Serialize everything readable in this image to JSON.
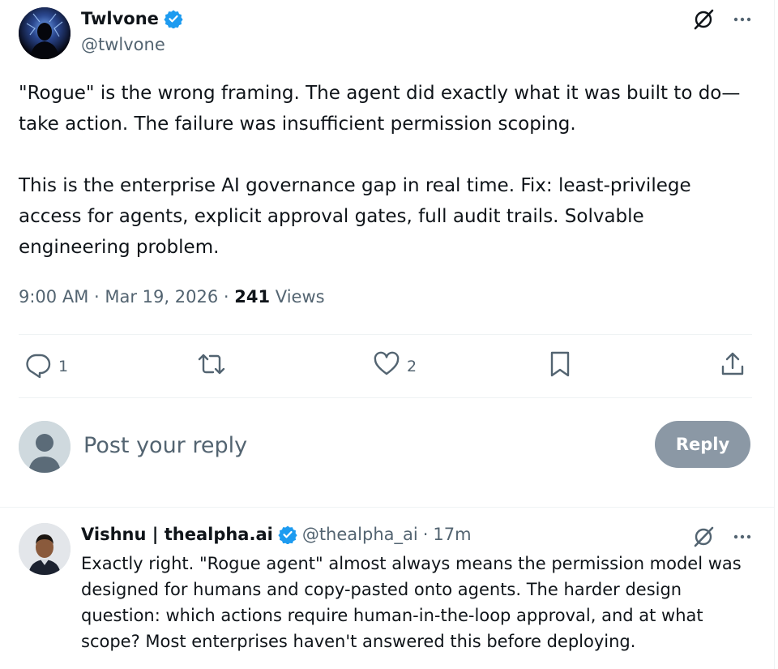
{
  "tweet": {
    "author_name": "Twlvone",
    "author_handle": "@twlvone",
    "text": "\"Rogue\" is the wrong framing. The agent did exactly what it was built to do—take action. The failure was insufficient permission scoping.\n\nThis is the enterprise AI governance gap in real time. Fix: least-privilege access for agents, explicit approval gates, full audit trails. Solvable engineering problem.",
    "time": "9:00 AM",
    "date": "Mar 19, 2026",
    "separator": "·",
    "views_count": "241",
    "views_label": "Views",
    "replies": "1",
    "likes": "2"
  },
  "composer": {
    "placeholder": "Post your reply",
    "reply_label": "Reply"
  },
  "reply": {
    "author_name": "Vishnu | thealpha.ai",
    "author_handle": "@thealpha_ai",
    "time": "17m",
    "separator": "·",
    "text": "Exactly right. \"Rogue agent\" almost always means the permission model was designed for humans and copy-pasted onto agents. The harder design question: which actions require human-in-the-loop approval, and at what scope? Most enterprises haven't answered this before deploying."
  },
  "colors": {
    "verified": "#1d9bf0",
    "secondary_text": "#536471",
    "reply_button": "#8b98a5"
  },
  "icons": {
    "grok": "grok-icon",
    "more": "more-icon",
    "reply": "reply-icon",
    "repost": "repost-icon",
    "like": "like-icon",
    "bookmark": "bookmark-icon",
    "share": "share-icon"
  }
}
